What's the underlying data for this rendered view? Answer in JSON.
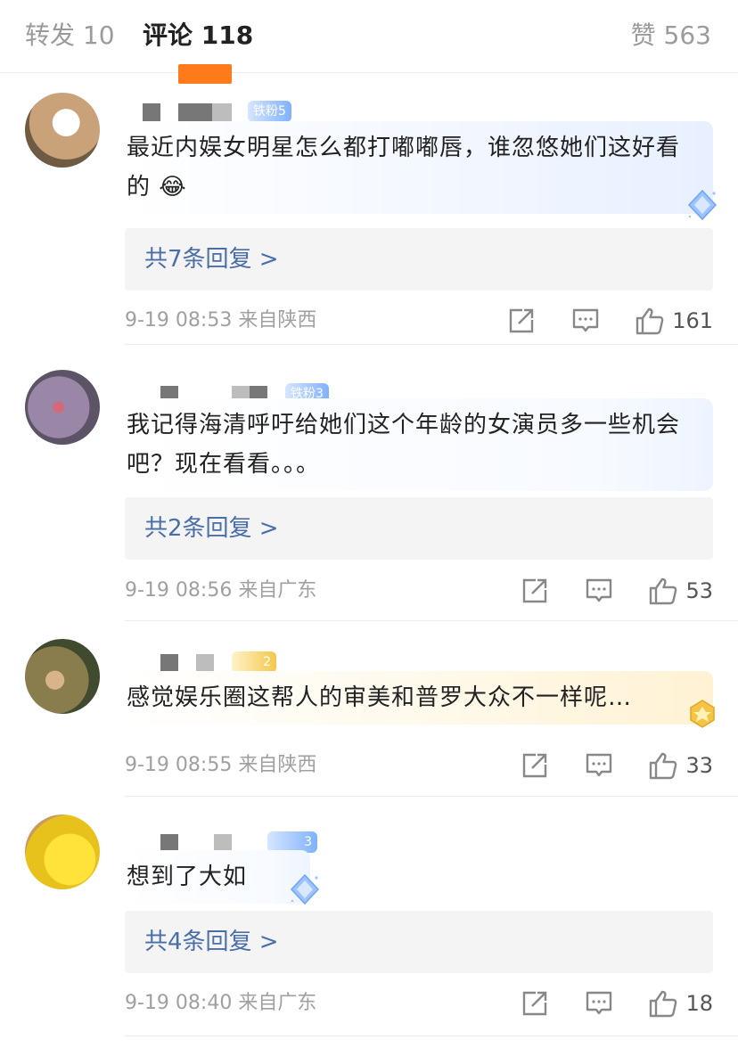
{
  "tabs": {
    "repost": "转发 10",
    "comments": "评论 118",
    "likes": "赞 563"
  },
  "accent_color": "#ff7a1a",
  "link_color": "#4a6ea8",
  "comments": [
    {
      "badge": "铁粉5",
      "text": "最近内娱女明星怎么都打嘟嘟唇，谁忽悠她们这好看的 😂",
      "replies": "共7条回复 >",
      "time": "9-19 08:53",
      "location": "来自陕西",
      "likes": "161",
      "style": "blue"
    },
    {
      "badge": "铁粉3",
      "text": "我记得海清呼吁给她们这个年龄的女演员多一些机会吧？现在看看。。。",
      "replies": "共2条回复 >",
      "time": "9-19 08:56",
      "location": "来自广东",
      "likes": "53",
      "style": "plain"
    },
    {
      "badge": "2",
      "text": "感觉娱乐圈这帮人的审美和普罗大众不一样呢…",
      "replies": "",
      "time": "9-19 08:55",
      "location": "来自陕西",
      "likes": "33",
      "style": "gold"
    },
    {
      "badge": "3",
      "text": "想到了大如",
      "replies": "共4条回复 >",
      "time": "9-19 08:40",
      "location": "来自广东",
      "likes": "18",
      "style": "blue"
    }
  ],
  "icons": {
    "share": "share-icon",
    "comment": "comment-icon",
    "like": "thumbs-up-icon",
    "gem": "diamond-badge-icon"
  }
}
